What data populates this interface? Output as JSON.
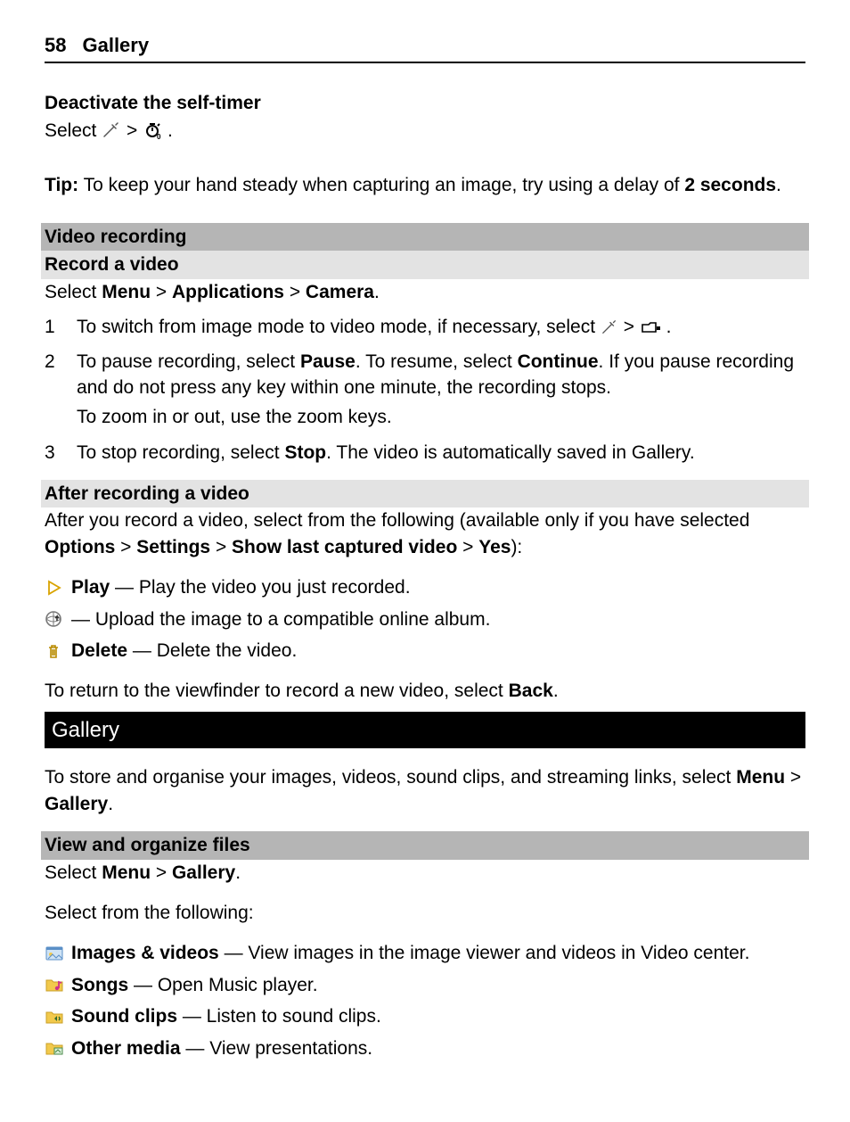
{
  "header": {
    "page_number": "58",
    "title": "Gallery"
  },
  "selftimer": {
    "title": "Deactivate the self-timer",
    "line_prefix": "Select ",
    "sep": " > ",
    "line_suffix": "."
  },
  "tip": {
    "label": "Tip:",
    "text_before": " To keep your hand steady when capturing an image, try using a delay of ",
    "bold": "2 seconds",
    "text_after": "."
  },
  "video": {
    "heading": "Video recording",
    "subheading": "Record a video",
    "path_prefix": "Select ",
    "menu": "Menu",
    "sep": " > ",
    "apps": "Applications",
    "camera": "Camera",
    "period": ".",
    "steps": [
      {
        "num": "1",
        "a": "To switch from image mode to video mode, if necessary, select ",
        "b": " > ",
        "c": "."
      },
      {
        "num": "2",
        "p1_a": "To pause recording, select ",
        "p1_b": "Pause",
        "p1_c": ". To resume, select ",
        "p1_d": "Continue",
        "p1_e": ". If you pause recording and do not press any key within one minute, the recording stops.",
        "p2": "To zoom in or out, use the zoom keys."
      },
      {
        "num": "3",
        "a": "To stop recording, select ",
        "b": "Stop",
        "c": ". The video is automatically saved in Gallery."
      }
    ]
  },
  "after": {
    "heading": "After recording a video",
    "intro_a": "After you record a video, select from the following (available only if you have selected ",
    "opt": "Options",
    "sep": " > ",
    "settings": "Settings",
    "show": "Show last captured video",
    "yes": "Yes",
    "intro_b": "):",
    "items": [
      {
        "bold": "Play",
        "text": " — Play the video you just recorded."
      },
      {
        "bold": "",
        "text": " — Upload the image to a compatible online album."
      },
      {
        "bold": "Delete",
        "text": " — Delete the video."
      }
    ],
    "outro_a": "To return to the viewfinder to record a new video, select ",
    "outro_b": "Back",
    "outro_c": "."
  },
  "gallery": {
    "heading": "Gallery",
    "intro_a": "To store and organise your images, videos, sound clips, and streaming links, select ",
    "menu": "Menu",
    "sep": " > ",
    "gallery": "Gallery",
    "intro_b": "."
  },
  "view": {
    "heading": "View and organize files",
    "path_a": "Select ",
    "menu": "Menu",
    "sep": " > ",
    "gallery": "Gallery",
    "path_b": ".",
    "lead": "Select from the following:",
    "items": [
      {
        "bold": "Images & videos",
        "text": " — View images in the image viewer and videos in Video center."
      },
      {
        "bold": "Songs",
        "text": " — Open Music player."
      },
      {
        "bold": "Sound clips",
        "text": " — Listen to sound clips."
      },
      {
        "bold": "Other media",
        "text": " — View presentations."
      }
    ]
  }
}
